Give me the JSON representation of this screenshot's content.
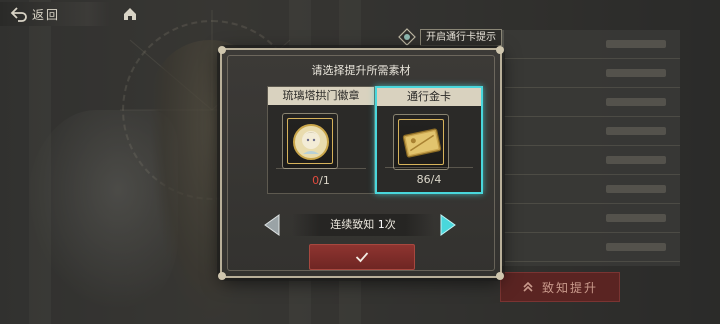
{
  "header": {
    "back_label": "返回",
    "back_icon": "back-arrow-icon",
    "home_icon": "home-icon"
  },
  "pass_tip": {
    "label": "开启通行卡提示",
    "icon": "gem-icon"
  },
  "modal": {
    "title": "请选择提升所需素材",
    "materials": [
      {
        "name": "琉璃塔拱门徽章",
        "owned": "0",
        "required": "/1",
        "selected": false,
        "icon": "portrait-badge-icon"
      },
      {
        "name": "通行金卡",
        "owned": "86",
        "required": "/4",
        "selected": true,
        "icon": "gold-card-icon"
      }
    ],
    "quantity": {
      "prefix": "连续致知",
      "value": "1",
      "suffix": "次"
    },
    "confirm_icon": "checkmark-icon"
  },
  "right_panel": {
    "notify_label": "致知提升",
    "notify_icon": "double-chevron-up-icon"
  },
  "colors": {
    "accent_selected": "#49d7dc",
    "confirm_red": "#8e3430",
    "insufficient": "#e04b3e"
  }
}
